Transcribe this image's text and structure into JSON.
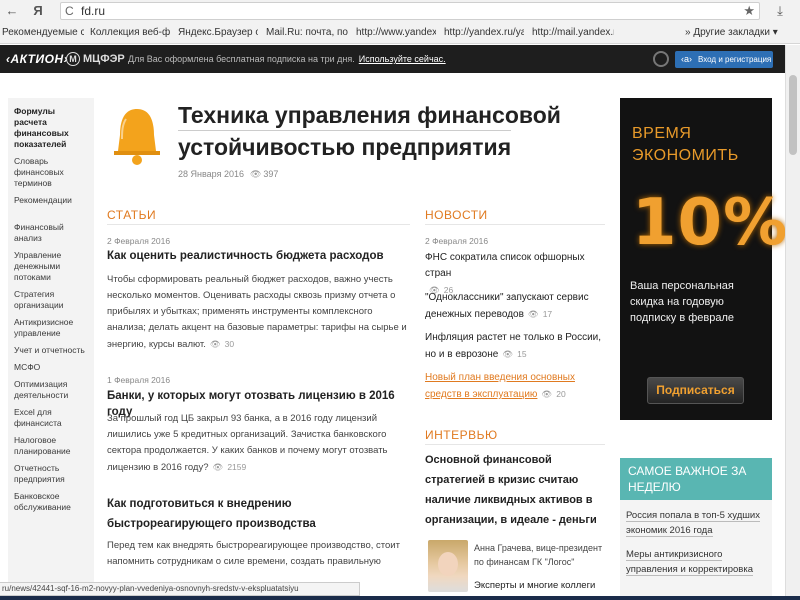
{
  "browser": {
    "back_glyph": "←",
    "yandex_glyph": "Я",
    "reload_glyph": "C",
    "url": "fd.ru",
    "bookmark_star": "★",
    "download_glyph": "⤓",
    "bookmarks": [
      "Рекомендуемые са",
      "Коллекция веб-фра",
      "Яндекс.Браузер об",
      "Mail.Ru: почта, поис",
      "http://www.yandex.r",
      "http://yandex.ru/yan",
      "http://mail.yandex.r"
    ],
    "more_bookmarks": "» Другие закладки ▾"
  },
  "site_bar": {
    "logo_aktion": "‹АКТИОН›",
    "logo_mcfer": "МЦФЭР",
    "promo_text": "Для Вас оформлена бесплатная подписка на три дня.",
    "promo_link": "Используйте сейчас.",
    "login_label": "Вход и регистрация"
  },
  "sidebar": {
    "items": [
      "Формулы расчета финансовых показателей",
      "Словарь финансовых терминов",
      "Рекомендации",
      "Финансовый анализ",
      "Управление денежными потоками",
      "Стратегия организации",
      "Антикризисное управление",
      "Учет и отчетность",
      "МСФО",
      "Оптимизация деятельности",
      "Excel для финансиста",
      "Налоговое планирование",
      "Отчетность предприятия",
      "Банковское обслуживание"
    ]
  },
  "page": {
    "title_line1": "Техника управления финансовой",
    "title_line2": "устойчивостью предприятия",
    "date": "28 Января 2016",
    "views": "397"
  },
  "articles": {
    "heading": "СТАТЬИ",
    "items": [
      {
        "date": "2 Февраля 2016",
        "title": "Как оценить реалистичность бюджета расходов",
        "text": "Чтобы сформировать реальный бюджет расходов, важно учесть несколько моментов. Оценивать расходы сквозь призму отчета о прибылях и убытках; применять инструменты комплексного анализа; делать акцент на базовые параметры: тарифы на сырье и энергию, курсы валют.",
        "views": "30"
      },
      {
        "date": "1 Февраля 2016",
        "title": "Банки, у которых могут отозвать лицензию в 2016 году",
        "text": "За прошлый год ЦБ закрыл 93 банка, а в 2016 году лицензий лишились уже 5 кредитных организаций. Зачистка банковского сектора продолжается. У каких банков и почему могут отозвать лицензию в 2016 году?",
        "views": "2159"
      },
      {
        "title": "Как подготовиться к внедрению быстрореагирующего производства",
        "text": "Перед тем как внедрять быстрореагирующее производство, стоит напомнить сотрудникам о силе времени, создать правильную"
      }
    ]
  },
  "news": {
    "heading": "НОВОСТИ",
    "date": "2 Февраля 2016",
    "items": [
      {
        "title": "ФНС сократила список офшорных стран",
        "views": "26"
      },
      {
        "title": "\"Одноклассники\" запускают сервис денежных переводов",
        "views": "17"
      },
      {
        "title": "Инфляция растет не только в России, но и в еврозоне",
        "views": "15"
      },
      {
        "title": "Новый план введения основных средств в эксплуатацию",
        "views": "20"
      }
    ]
  },
  "interview": {
    "heading": "ИНТЕРВЬЮ",
    "title": "Основной финансовой стратегией в кризис считаю наличие ликвидных активов в организации, в идеале - деньги",
    "person": "Анна Грачева, вице-президент по финансам ГК \"Логос\"",
    "more": "Эксперты и многие коллеги"
  },
  "ad": {
    "line1": "ВРЕМЯ",
    "line2": "ЭКОНОМИТЬ",
    "percent": "10%",
    "text": "Ваша персональная скидка на годовую подписку в феврале",
    "button": "Подписаться"
  },
  "important": {
    "heading": "САМОЕ ВАЖНОЕ ЗА НЕДЕЛЮ",
    "items": [
      "Россия попала в топ-5 худших экономик 2016 года",
      "Меры антикризисного управления и корректировка"
    ]
  },
  "status_bar": {
    "text": "ru/news/42441-sqf-16-m2-novyy-plan-vvedeniya-osnovnyh-sredstv-v-ekspluatatsiyu"
  },
  "colors": {
    "accent_orange": "#e07a20",
    "site_bar_bg": "#1e1e1e",
    "login_blue": "#2d6fb5",
    "teal_heading": "#59b6b2"
  }
}
